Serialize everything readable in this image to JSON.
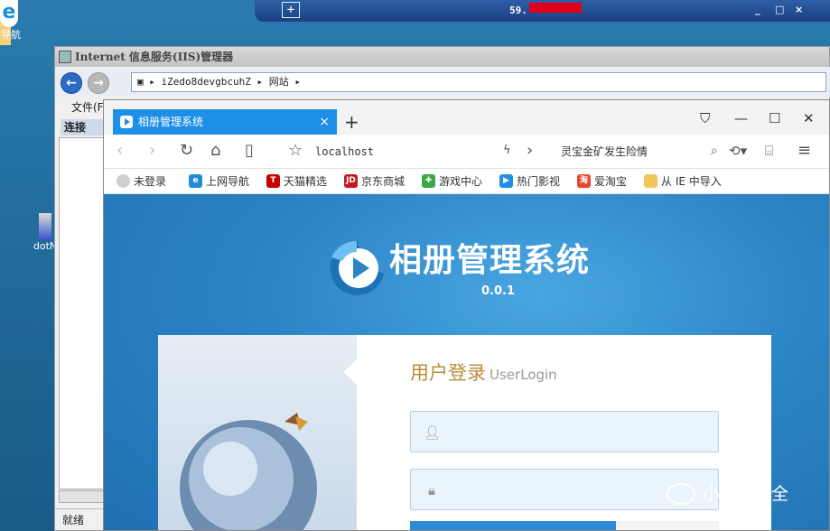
{
  "rdp": {
    "ip_visible": "59.",
    "pin": "+",
    "minimize": "_",
    "restore": "□",
    "close": "×"
  },
  "desktop": {
    "ie_label": "导航",
    "dot_label": "dotN"
  },
  "iis": {
    "title": "Internet 信息服务(IIS)管理器",
    "path_server": "iZedo8devgbcuhZ",
    "path_site": "网站",
    "menu_file": "文件(F)",
    "connections": "连接",
    "status": "就绪"
  },
  "browser": {
    "tab_title": "相册管理系统",
    "url": "localhost",
    "news": "灵宝金矿发生险情",
    "bookmarks": [
      {
        "label": "未登录",
        "icon": "user-icon",
        "color": "#cfcfcf"
      },
      {
        "label": "上网导航",
        "icon": "ie-icon",
        "color": "#1f8dd6"
      },
      {
        "label": "天猫精选",
        "icon": "tmall-icon",
        "color": "#c40000"
      },
      {
        "label": "京东商城",
        "icon": "jd-icon",
        "color": "#c81623"
      },
      {
        "label": "游戏中心",
        "icon": "gamepad-icon",
        "color": "#3aa845"
      },
      {
        "label": "热门影视",
        "icon": "play-icon",
        "color": "#1d8fe6"
      },
      {
        "label": "爱淘宝",
        "icon": "taobao-icon",
        "color": "#e6462c"
      },
      {
        "label": "从 IE 中导入",
        "icon": "folder-icon",
        "color": "#f0c75e"
      }
    ]
  },
  "page": {
    "brand": "相册管理系统",
    "version": "0.0.1",
    "login_title": "用户登录",
    "login_subtitle": "UserLogin",
    "username_value": "",
    "password_value": ""
  },
  "watermark": "小兵搞安全",
  "colors": {
    "tab_blue": "#1d8fe6",
    "page_blue": "#2b84c5",
    "login_gold": "#b88c3b",
    "field_bg": "#eaf4fc"
  }
}
